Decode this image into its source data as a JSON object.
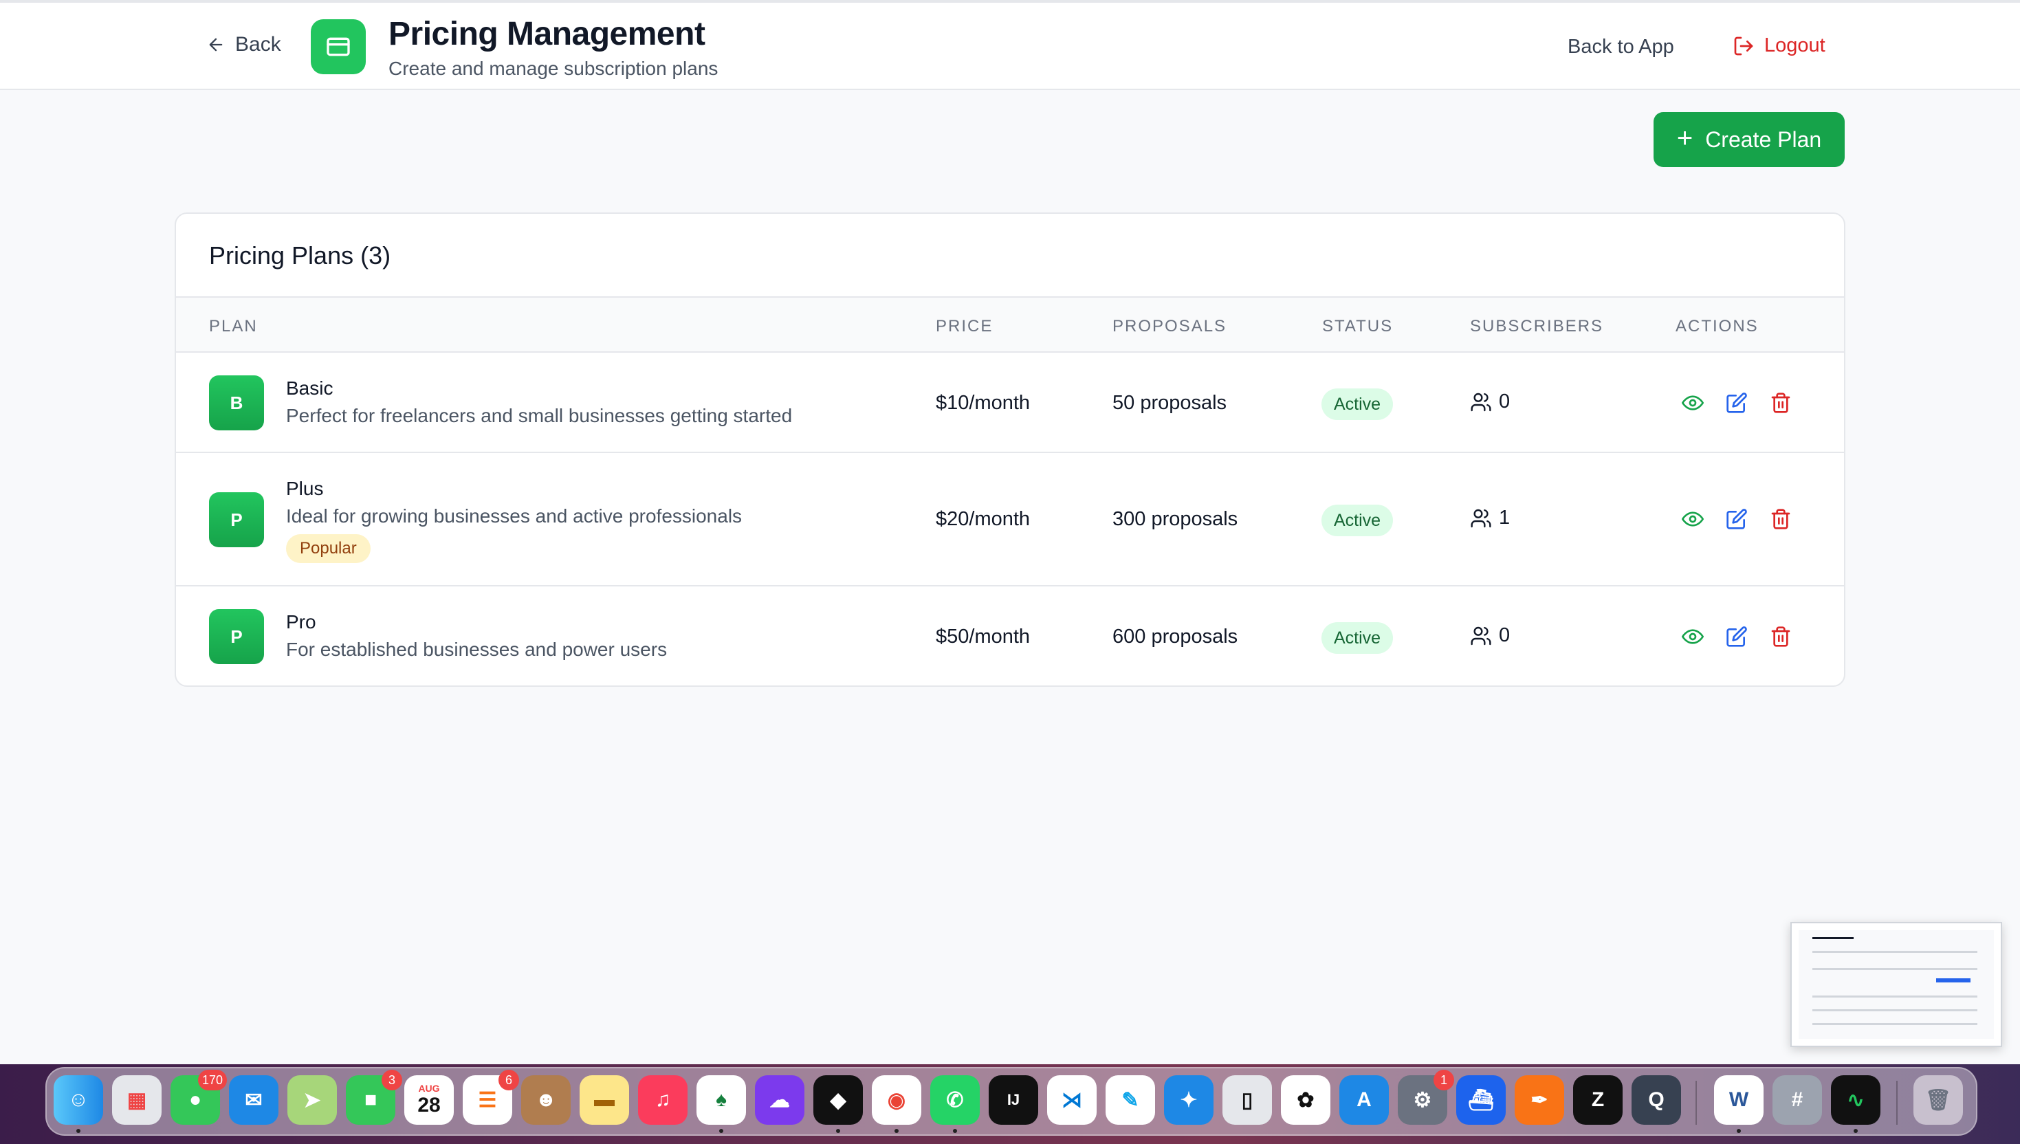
{
  "header": {
    "back_label": "Back",
    "title": "Pricing Management",
    "subtitle": "Create and manage subscription plans",
    "back_to_app_label": "Back to App",
    "logout_label": "Logout"
  },
  "toolbar": {
    "create_plan_label": "Create Plan"
  },
  "plans_table": {
    "title": "Pricing Plans (3)",
    "columns": [
      "PLAN",
      "PRICE",
      "PROPOSALS",
      "STATUS",
      "SUBSCRIBERS",
      "ACTIONS"
    ],
    "rows": [
      {
        "initial": "B",
        "name": "Basic",
        "description": "Perfect for freelancers and small businesses getting started",
        "badge": "",
        "price": "$10/month",
        "proposals": "50 proposals",
        "status": "Active",
        "subscribers": "0"
      },
      {
        "initial": "P",
        "name": "Plus",
        "description": "Ideal for growing businesses and active professionals",
        "badge": "Popular",
        "price": "$20/month",
        "proposals": "300 proposals",
        "status": "Active",
        "subscribers": "1"
      },
      {
        "initial": "P",
        "name": "Pro",
        "description": "For established businesses and power users",
        "badge": "",
        "price": "$50/month",
        "proposals": "600 proposals",
        "status": "Active",
        "subscribers": "0"
      }
    ]
  },
  "colors": {
    "brand_green": "#16a34a",
    "status_active_bg": "#dcfce7",
    "popular_badge_bg": "#fef3c7",
    "danger_red": "#dc2626",
    "edit_blue": "#2563eb"
  },
  "dock": {
    "icons": [
      "finder-icon",
      "launchpad-icon",
      "messages-icon",
      "mail-icon",
      "maps-icon",
      "facetime-icon",
      "calendar-icon",
      "reminders-icon",
      "contacts-icon",
      "notes-icon",
      "music-icon",
      "mongodb-icon",
      "ghost-icon",
      "cursor-icon",
      "chrome-icon",
      "whatsapp-icon",
      "intellij-icon",
      "vscode-icon",
      "freeform-icon",
      "safari-icon",
      "iphone-mirroring-icon",
      "chatgpt-icon",
      "app-store-icon",
      "system-settings-icon",
      "docker-icon",
      "pen-icon",
      "zed-icon",
      "quicktime-icon",
      "word-icon",
      "calculator-icon",
      "activity-monitor-icon",
      "trash-icon"
    ],
    "badges": {
      "messages": "170",
      "facetime": "3",
      "reminders": "6",
      "system_settings": "1"
    },
    "calendar_month": "AUG",
    "calendar_day": "28",
    "word_letter": "W"
  }
}
